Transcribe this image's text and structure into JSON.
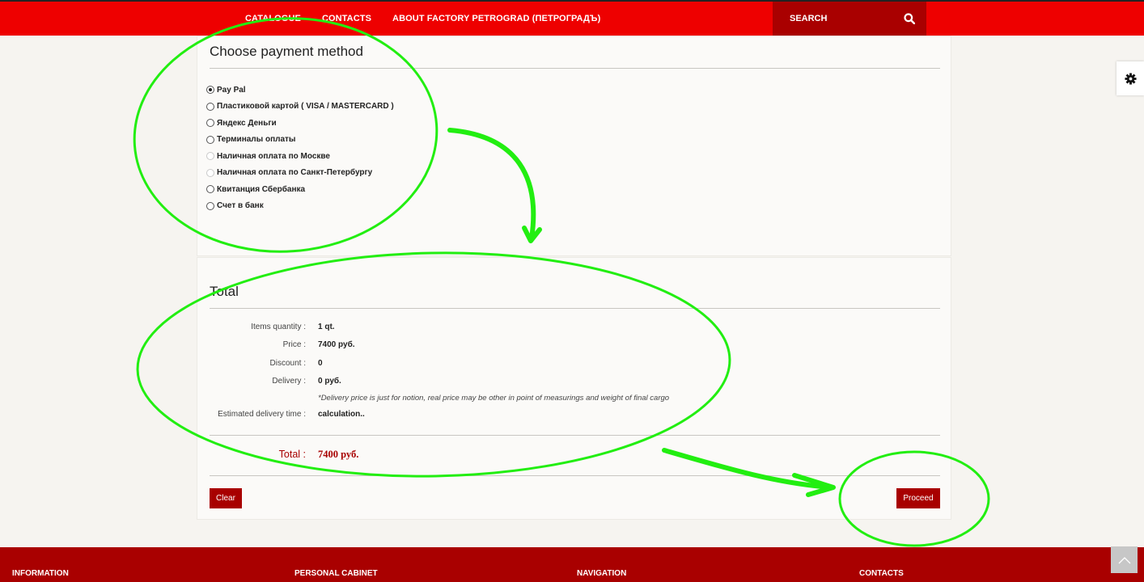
{
  "nav": {
    "items": [
      "Catalogue",
      "Contacts",
      "About factory Petrograd (Петроградъ)"
    ],
    "search_placeholder": "SEARCH"
  },
  "payment": {
    "title": "Choose payment method",
    "methods": [
      {
        "label": "Pay Pal",
        "selected": true,
        "disabled": false
      },
      {
        "label": "Пластиковой картой ( VISA / MASTERCARD )",
        "selected": false,
        "disabled": false
      },
      {
        "label": "Яндекс Деньги",
        "selected": false,
        "disabled": false
      },
      {
        "label": "Терминалы оплаты",
        "selected": false,
        "disabled": false
      },
      {
        "label": "Наличная оплата по Москве",
        "selected": false,
        "disabled": true
      },
      {
        "label": "Наличная оплата по Санкт-Петербургу",
        "selected": false,
        "disabled": true
      },
      {
        "label": "Квитанция Сбербанка",
        "selected": false,
        "disabled": false
      },
      {
        "label": "Счет в банк",
        "selected": false,
        "disabled": false
      }
    ]
  },
  "total": {
    "title": "Total",
    "rows": {
      "quantity": {
        "label": "Items quantity :",
        "value": "1 qt."
      },
      "price": {
        "label": "Price :",
        "value": "7400 руб."
      },
      "discount": {
        "label": "Discount :",
        "value": "0"
      },
      "delivery": {
        "label": "Delivery :",
        "value": "0 руб."
      },
      "eta": {
        "label": "Estimated delivery time :",
        "value": "calculation.."
      }
    },
    "delivery_note": "*Delivery price is just for notion, real price may be other in point of measurings and weight of final cargo",
    "grand_label": "Total :",
    "grand_value": "7400 руб."
  },
  "buttons": {
    "clear": "Clear",
    "proceed": "Proceed"
  },
  "footer": {
    "columns": [
      "Information",
      "Personal cabinet",
      "Navigation",
      "Contacts"
    ]
  },
  "colors": {
    "primary_red": "#ee0000",
    "dark_red": "#a80000",
    "annotation_green": "#22ee11"
  }
}
